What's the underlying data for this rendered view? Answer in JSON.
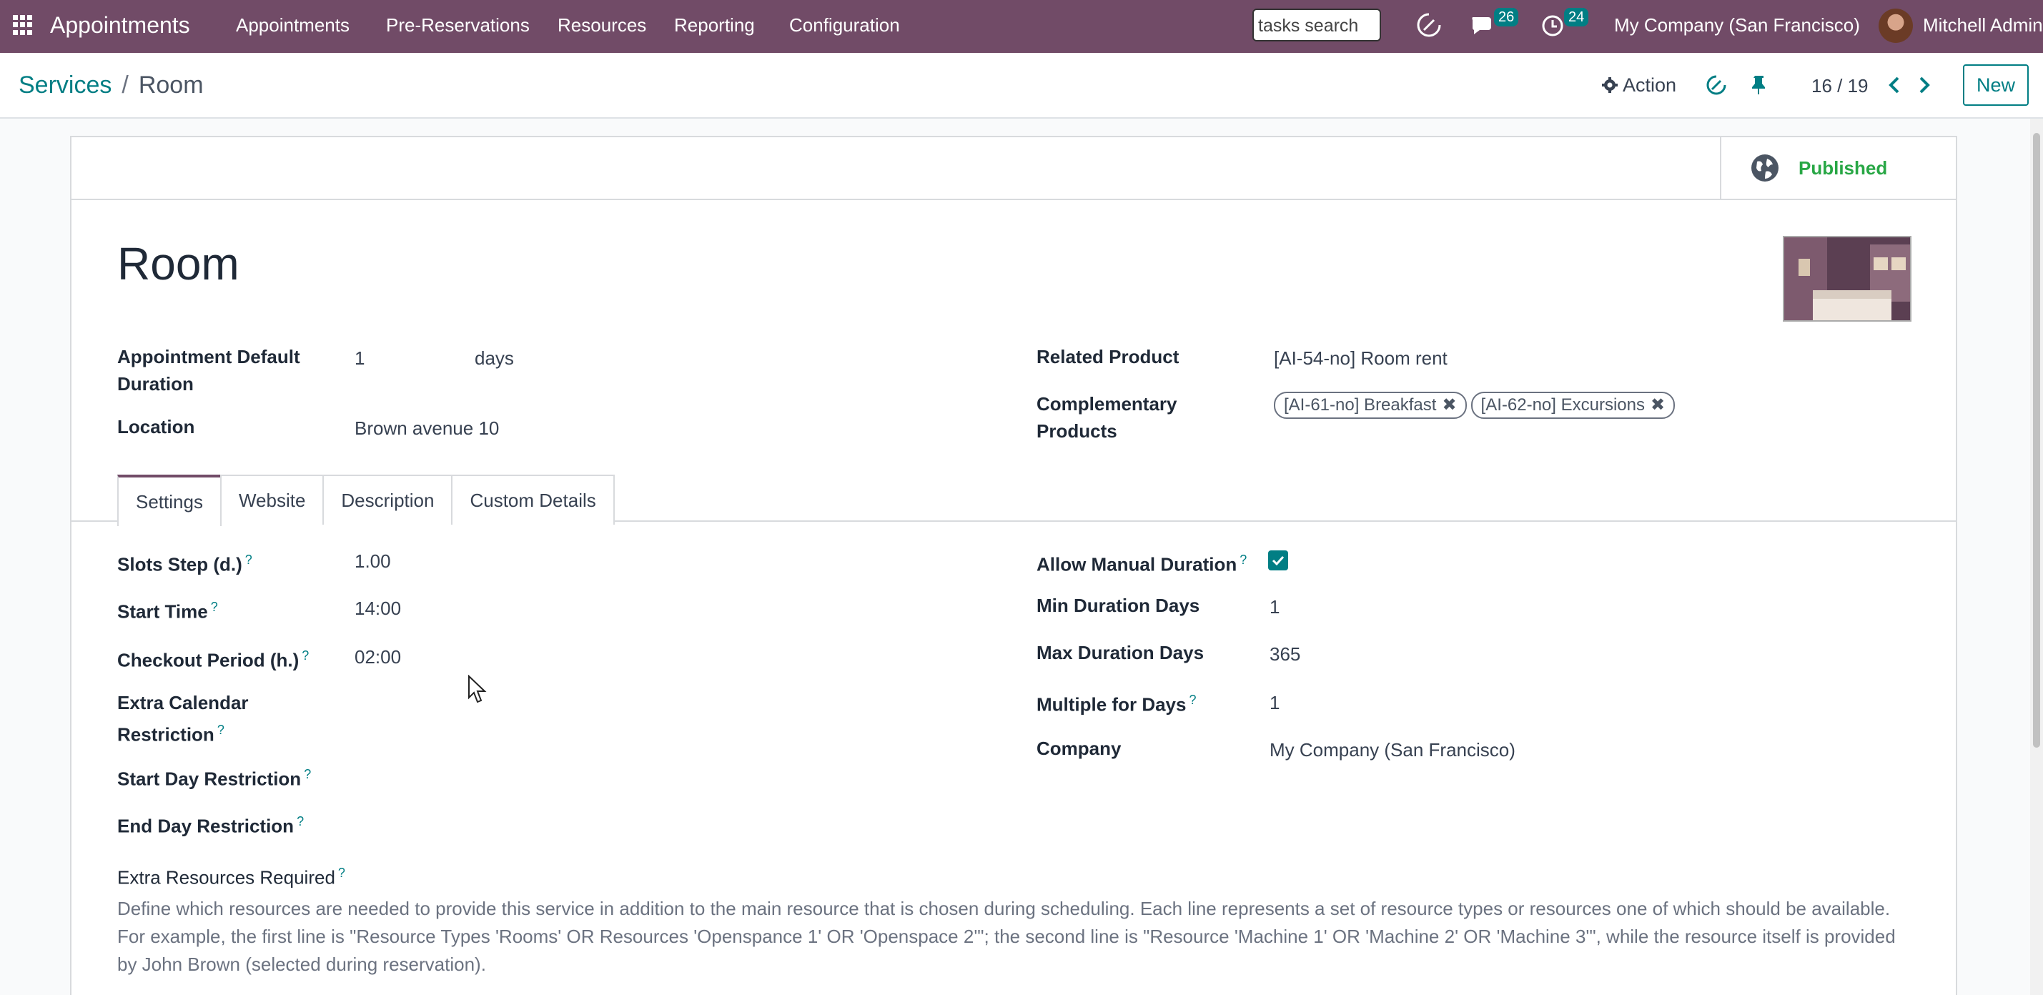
{
  "navbar": {
    "brand": "Appointments",
    "menu": [
      "Appointments",
      "Pre-Reservations",
      "Resources",
      "Reporting",
      "Configuration"
    ],
    "search_value": "tasks search",
    "messages_count": "26",
    "activities_count": "24",
    "company": "My Company (San Francisco)",
    "user": "Mitchell Admin"
  },
  "control_panel": {
    "breadcrumb_parent": "Services",
    "breadcrumb_separator": "/",
    "breadcrumb_current": "Room",
    "action_label": "Action",
    "pager": "16 / 19",
    "new_label": "New"
  },
  "smart_buttons": {
    "published": "Published"
  },
  "record": {
    "title": "Room",
    "duration_label": "Appointment Default Duration",
    "duration_value": "1",
    "duration_unit": "days",
    "location_label": "Location",
    "location_value": "Brown avenue 10",
    "related_product_label": "Related Product",
    "related_product_value": "[AI-54-no] Room rent",
    "complementary_label": "Complementary Products",
    "complementary_tags": [
      "[AI-61-no] Breakfast",
      "[AI-62-no] Excursions"
    ]
  },
  "tabs": [
    "Settings",
    "Website",
    "Description",
    "Custom Details"
  ],
  "settings": {
    "slots_step_label": "Slots Step (d.)",
    "slots_step_value": "1.00",
    "start_time_label": "Start Time",
    "start_time_value": "14:00",
    "checkout_label": "Checkout Period (h.)",
    "checkout_value": "02:00",
    "extra_calendar_label": "Extra Calendar Restriction",
    "start_day_label": "Start Day Restriction",
    "end_day_label": "End Day Restriction",
    "allow_manual_label": "Allow Manual Duration",
    "allow_manual_checked": true,
    "min_days_label": "Min Duration Days",
    "min_days_value": "1",
    "max_days_label": "Max Duration Days",
    "max_days_value": "365",
    "multiple_label": "Multiple for Days",
    "multiple_value": "1",
    "company_label": "Company",
    "company_value": "My Company (San Francisco)",
    "extra_resources_label": "Extra Resources Required",
    "extra_resources_desc": "Define which resources are needed to provide this service in addition to the main resource that is chosen during scheduling. Each line represents a set of resource types or resources one of which should be available. For example, the first line is \"Resource Types 'Rooms' OR Resources 'Openspance 1' OR 'Openspace 2'\"; the second line is \"Resource 'Machine 1' OR 'Machine 2' OR 'Machine 3'\", while the resource itself is provided by John Brown (selected during reservation)."
  },
  "help_mark": "?",
  "colors": {
    "brand": "#714b67",
    "accent": "#017e84",
    "published": "#28a745"
  }
}
